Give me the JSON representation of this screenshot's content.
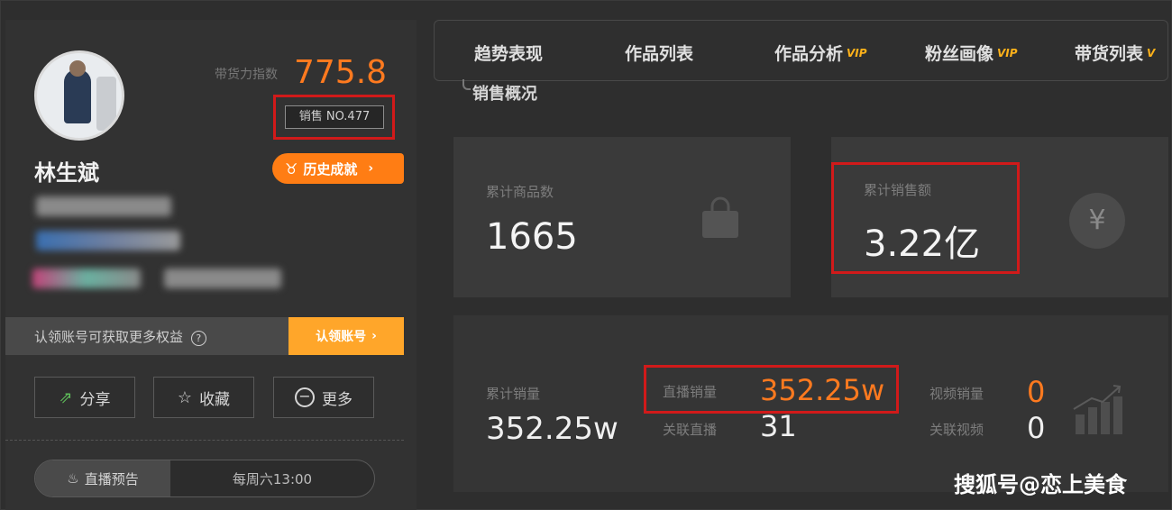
{
  "profile": {
    "name": "林生斌",
    "score_label": "带货力指数",
    "score_value": "775.8",
    "rank": "销售 NO.477",
    "history_button": "历史成就",
    "history_chevron": "›"
  },
  "auth": {
    "text": "认领账号可获取更多权益",
    "info_icon": "?",
    "button_label": "认领账号",
    "button_chevron": "›"
  },
  "actions": {
    "share": "分享",
    "favorite": "收藏",
    "more": "更多"
  },
  "live": {
    "tag": "直播预告",
    "time": "每周六13:00"
  },
  "tabs": [
    {
      "label": "趋势表现",
      "vip": ""
    },
    {
      "label": "作品列表",
      "vip": ""
    },
    {
      "label": "作品分析",
      "vip": "VIP"
    },
    {
      "label": "粉丝画像",
      "vip": "VIP"
    },
    {
      "label": "带货列表",
      "vip": "V"
    }
  ],
  "section": {
    "title": "销售概况"
  },
  "stats": {
    "orders_label": "累计商品数",
    "orders_value": "1665",
    "sales_label": "累计销售额",
    "sales_value": "3.22亿",
    "yen_symbol": "¥",
    "total_volume_label": "累计销量",
    "total_volume_value": "352.25w",
    "live_volume_label": "直播销量",
    "live_volume_value": "352.25w",
    "live_count_label": "关联直播",
    "live_count_value": "31",
    "video_volume_label": "视频销量",
    "video_volume_value": "0",
    "video_count_label": "关联视频",
    "video_count_value": "0"
  },
  "watermark": "搜狐号@恋上美食",
  "colors": {
    "accent_orange": "#ff7a1f",
    "highlight_red": "#d11a1a",
    "vip_gold": "#ffb21a"
  }
}
